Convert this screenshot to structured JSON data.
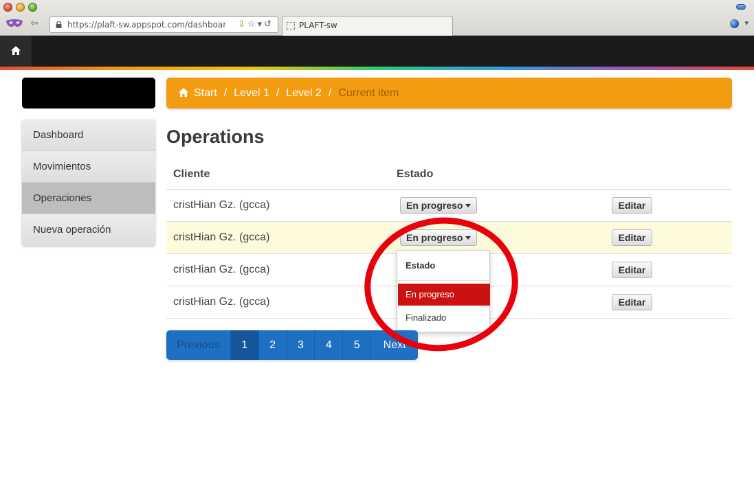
{
  "browser": {
    "url": "https://plaft-sw.appspot.com/dashboarc",
    "tab_title": "PLAFT-sw"
  },
  "breadcrumb": {
    "items": [
      "Start",
      "Level 1",
      "Level 2"
    ],
    "current": "Current item",
    "separator": "/"
  },
  "sidebar": {
    "items": [
      {
        "label": "Dashboard"
      },
      {
        "label": "Movimientos"
      },
      {
        "label": "Operaciones"
      },
      {
        "label": "Nueva operación"
      }
    ]
  },
  "page": {
    "title": "Operations"
  },
  "table": {
    "columns": [
      "Cliente",
      "Estado"
    ],
    "rows": [
      {
        "cliente": "cristHian Gz. (gcca)",
        "estado": "En progreso",
        "edit_label": "Editar"
      },
      {
        "cliente": "cristHian Gz. (gcca)",
        "estado": "En progreso",
        "edit_label": "Editar"
      },
      {
        "cliente": "cristHian Gz. (gcca)",
        "estado": "",
        "edit_label": "Editar"
      },
      {
        "cliente": "cristHian Gz. (gcca)",
        "estado": "",
        "edit_label": "Editar"
      }
    ]
  },
  "dropdown": {
    "header": "Estado",
    "options": [
      "En progreso",
      "Finalizado"
    ],
    "selected": "En progreso"
  },
  "pagination": {
    "prev": "Previous",
    "pages": [
      "1",
      "2",
      "3",
      "4",
      "5"
    ],
    "current": "1",
    "next": "Next"
  },
  "colors": {
    "breadcrumb_bg": "#f39c12",
    "selected_option": "#cc1111",
    "pagination_bg": "#1f6fc3",
    "annotation": "#e8000b"
  }
}
